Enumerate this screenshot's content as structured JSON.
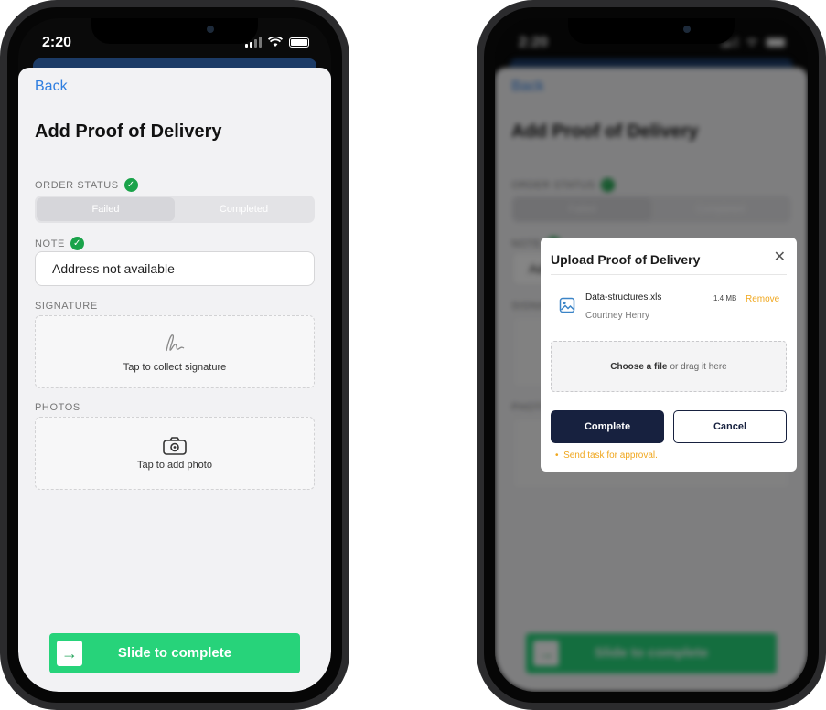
{
  "status": {
    "time": "2:20"
  },
  "left": {
    "back": "Back",
    "title": "Add Proof of Delivery",
    "order_status_label": "ORDER STATUS",
    "segments": [
      "Failed",
      "Completed"
    ],
    "note_label": "NOTE",
    "note_value": "Address not available",
    "signature_label": "SIGNATURE",
    "signature_hint": "Tap to collect signature",
    "photos_label": "PHOTOS",
    "photo_hint": "Tap to add photo",
    "slide_label": "Slide to complete"
  },
  "modal": {
    "title": "Upload Proof of Delivery",
    "file": {
      "name": "Data-structures.xls",
      "owner": "Courtney Henry",
      "size": "1.4 MB",
      "remove": "Remove"
    },
    "drop_strong": "Choose a file",
    "drop_rest": "or drag it here",
    "complete": "Complete",
    "cancel": "Cancel",
    "hint": "Send task for approval."
  },
  "colors": {
    "accent": "#27d37a",
    "link": "#2e7ee0",
    "primary": "#17213f",
    "warning": "#f0a71e"
  }
}
